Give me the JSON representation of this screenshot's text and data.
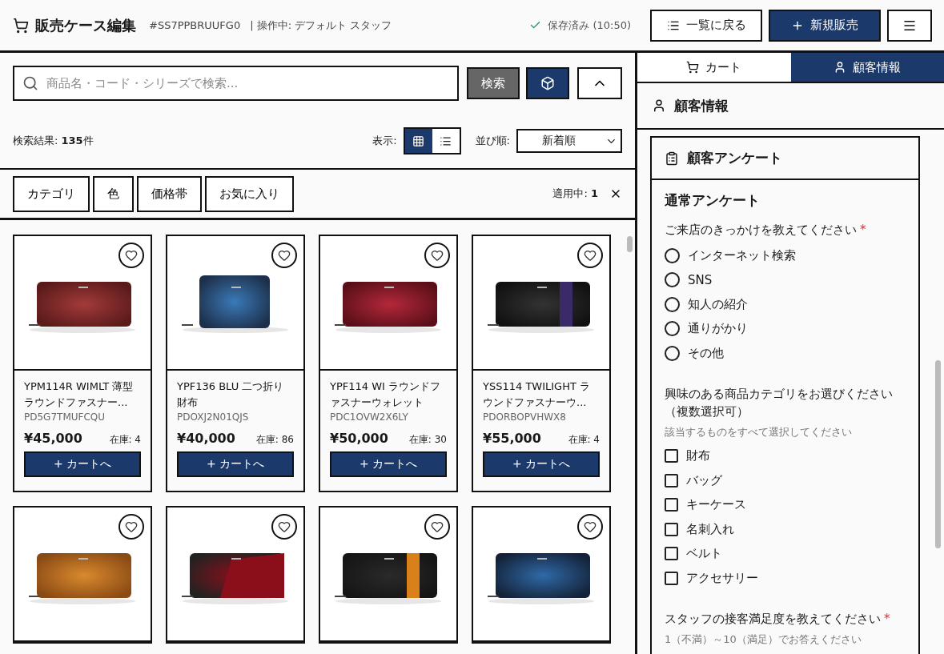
{
  "header": {
    "title": "販売ケース編集",
    "case_id": "#SS7PPBRUUFG0",
    "operator": "| 操作中: デフォルト スタッフ",
    "save_status": "保存済み (10:50)",
    "buttons": [
      {
        "kind": "outline",
        "label": "一覧に戻る"
      },
      {
        "kind": "primary",
        "label": "新規販売"
      },
      {
        "kind": "menu"
      }
    ]
  },
  "search": {
    "placeholder": "商品名・コード・シリーズで検索...",
    "button": "検索"
  },
  "results": {
    "label": "検索結果: ",
    "count": "135",
    "unit": "件",
    "view_label": "表示:",
    "views": [
      {
        "kind": "grid",
        "selected": true
      },
      {
        "kind": "list",
        "selected": false
      }
    ],
    "sort_label": "並び順:",
    "sort_value": "新着順"
  },
  "filters": {
    "chips": [
      "カテゴリ",
      "色",
      "価格帯",
      "お気に入り"
    ],
    "applied_label": "適用中: ",
    "applied_count": "1"
  },
  "products": [
    {
      "title": "YPM114R WIMLT 薄型ラウンドファスナー...",
      "code": "PD5G7TMUFCQU",
      "price": "¥45,000",
      "stock": "在庫: 4",
      "button": "+ カートへ",
      "favorite": false
    },
    {
      "title": "YPF136 BLU 二つ折り財布",
      "code": "PDOXJ2N01QJS",
      "price": "¥40,000",
      "stock": "在庫: 86",
      "button": "+ カートへ",
      "favorite": false
    },
    {
      "title": "YPF114 WI ラウンドファスナーウォレット",
      "code": "PDC1OVW2X6LY",
      "price": "¥50,000",
      "stock": "在庫: 30",
      "button": "+ カートへ",
      "favorite": false
    },
    {
      "title": "YSS114 TWILIGHT ラウンドファスナーウ...",
      "code": "PDORBOPVHWX8",
      "price": "¥55,000",
      "stock": "在庫: 4",
      "button": "+ カートへ",
      "favorite": false
    },
    {
      "favorite": false
    },
    {
      "favorite": false
    },
    {
      "favorite": false
    },
    {
      "favorite": false
    }
  ],
  "side_tabs": [
    {
      "kind": "cart",
      "label": "カート",
      "selected": false
    },
    {
      "kind": "customer",
      "label": "顧客情報",
      "selected": true
    }
  ],
  "side_title": "顧客情報",
  "survey": {
    "title": "顧客アンケート",
    "section": "通常アンケート",
    "questions": [
      {
        "kind": "radio",
        "label": "ご来店のきっかけを教えてください",
        "required_mark": "*",
        "options": [
          {
            "label": "インターネット検索",
            "selected": false
          },
          {
            "label": "SNS",
            "selected": false
          },
          {
            "label": "知人の紹介",
            "selected": false
          },
          {
            "label": "通りがかり",
            "selected": false
          },
          {
            "label": "その他",
            "selected": false
          }
        ]
      },
      {
        "kind": "checkbox",
        "label": "興味のある商品カテゴリをお選びください（複数選択可）",
        "hint": "該当するものをすべて選択してください",
        "options": [
          {
            "label": "財布",
            "checked": false
          },
          {
            "label": "バッグ",
            "checked": false
          },
          {
            "label": "キーケース",
            "checked": false
          },
          {
            "label": "名刺入れ",
            "checked": false
          },
          {
            "label": "ベルト",
            "checked": false
          },
          {
            "label": "アクセサリー",
            "checked": false
          }
        ]
      },
      {
        "kind": "scale",
        "label": "スタッフの接客満足度を教えてください",
        "required_mark": "*",
        "hint": "1（不満）～10（満足）でお答えください"
      }
    ]
  }
}
